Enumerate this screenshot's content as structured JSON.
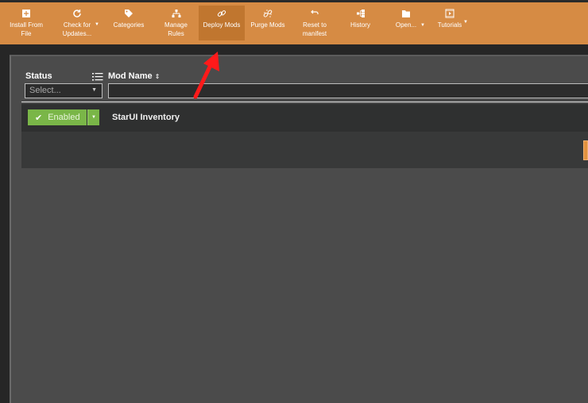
{
  "toolbar": {
    "items": [
      {
        "label": "Install From\nFile",
        "icon": "plus-square-icon"
      },
      {
        "label": "Check for\nUpdates...",
        "icon": "refresh-icon",
        "has_dropdown": true
      },
      {
        "label": "Categories",
        "icon": "tag-icon"
      },
      {
        "label": "Manage\nRules",
        "icon": "hierarchy-icon"
      },
      {
        "label": "Deploy Mods",
        "icon": "link-icon",
        "active": true
      },
      {
        "label": "Purge Mods",
        "icon": "broken-link-icon"
      },
      {
        "label": "Reset to\nmanifest",
        "icon": "undo-icon"
      },
      {
        "label": "History",
        "icon": "history-tree-icon"
      },
      {
        "label": "Open...",
        "icon": "folder-icon",
        "has_dropdown": true
      },
      {
        "label": "Tutorials",
        "icon": "video-icon",
        "has_dropdown": true
      }
    ],
    "dropdown_glyph": "▼"
  },
  "table": {
    "columns": [
      {
        "label": "Status",
        "filter_placeholder": "Select..."
      },
      {
        "label": "Mod Name",
        "sort_glyph": "⌃⌄",
        "filter_value": ""
      }
    ],
    "rows": [
      {
        "status": "Enabled",
        "status_glyph": "✔",
        "name": "StarUI Inventory"
      }
    ]
  },
  "colors": {
    "toolbar": "#d68b44",
    "toolbar_active": "#c0762f",
    "enabled_green": "#7ab648",
    "panel": "#4b4b4b",
    "annotation_arrow": "#ff0000"
  }
}
